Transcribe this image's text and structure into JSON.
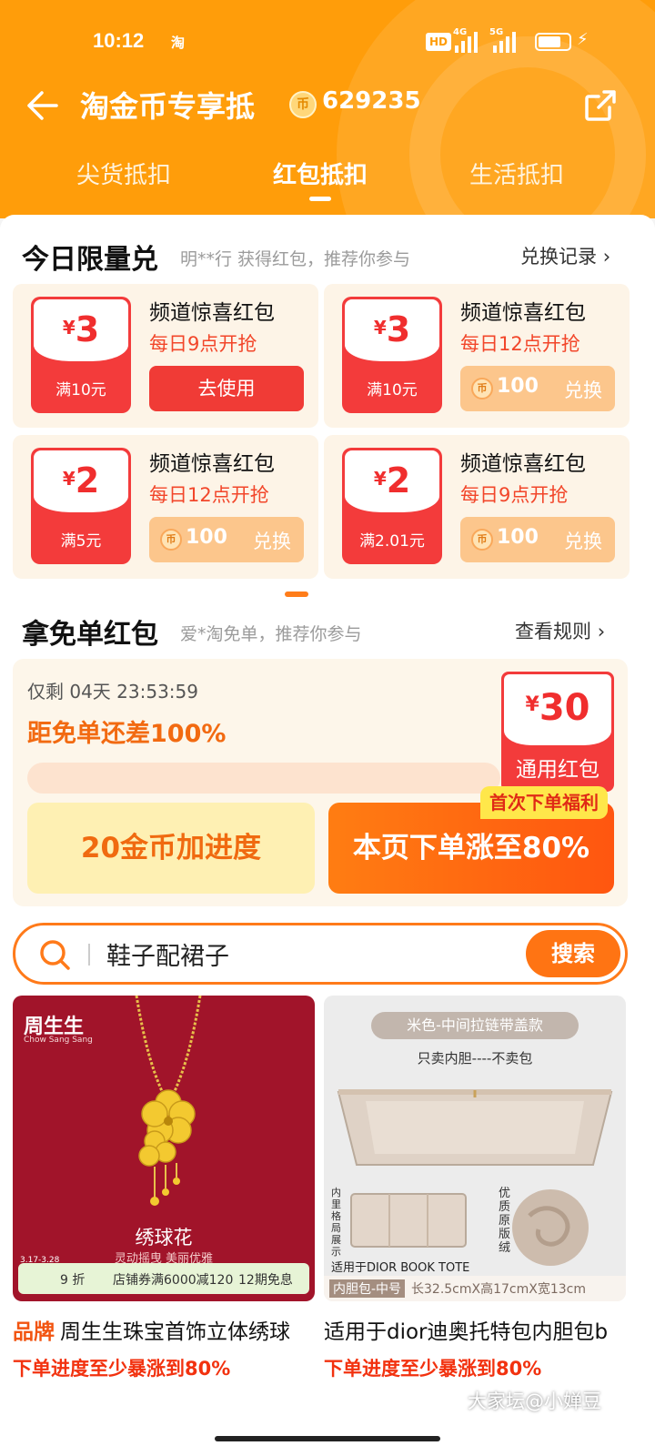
{
  "status": {
    "time": "10:12",
    "app_icon": "淘",
    "hd": "HD",
    "net1": "4G",
    "net2": "5G"
  },
  "header": {
    "title": "淘金币专享抵",
    "coin_count": "629235",
    "coin_glyph": "币"
  },
  "tabs": [
    {
      "label": "尖货抵扣",
      "active": false
    },
    {
      "label": "红包抵扣",
      "active": true
    },
    {
      "label": "生活抵扣",
      "active": false
    }
  ],
  "limited": {
    "title": "今日限量兑",
    "subtitle": "明**行 获得红包，推荐你参与",
    "link": "兑换记录",
    "coupons": [
      {
        "yen": "¥",
        "amount": "3",
        "condition": "满10元",
        "name": "频道惊喜红包",
        "time": "每日9点开抢",
        "action": "去使用"
      },
      {
        "yen": "¥",
        "amount": "3",
        "condition": "满10元",
        "name": "频道惊喜红包",
        "time": "每日12点开抢",
        "cost": "100",
        "action": "兑换"
      },
      {
        "yen": "¥",
        "amount": "2",
        "condition": "满5元",
        "name": "频道惊喜红包",
        "time": "每日12点开抢",
        "cost": "100",
        "action": "兑换"
      },
      {
        "yen": "¥",
        "amount": "2",
        "condition": "满2.01元",
        "name": "频道惊喜红包",
        "time": "每日9点开抢",
        "cost": "100",
        "action": "兑换"
      }
    ]
  },
  "free_order": {
    "title": "拿免单红包",
    "subtitle": "爱*淘免单，推荐你参与",
    "link": "查看规则",
    "countdown": "仅剩 04天 23:53:59",
    "gap": "距免单还差100%",
    "progress_fraction": 0,
    "packet_yen": "¥",
    "packet_amount": "30",
    "packet_label": "通用红包",
    "btn_coin": "20金币加进度",
    "btn_order": "本页下单涨至80%",
    "first_tag": "首次下单福利"
  },
  "search": {
    "value": "鞋子配裙子",
    "button": "搜索"
  },
  "products": [
    {
      "brand": "品牌",
      "title": "周生生珠宝首饰立体绣球",
      "promo": "下单进度至少暴涨到80%",
      "img": {
        "logo": "周生生",
        "logo_en": "Chow Sang Sang",
        "name": "绣球花",
        "desc": "灵动摇曳 美丽优雅",
        "date": "3.17-3.28",
        "s1": "9 折",
        "s2": "店铺券满6000减120",
        "s3": "12期免息"
      }
    },
    {
      "title": "适用于dior迪奥托特包内胆包b",
      "promo": "下单进度至少暴涨到80%",
      "img": {
        "tag": "米色-中间拉链带盖款",
        "note": "只卖内胆----不卖包",
        "side1": "内里格局展示",
        "side2": "优质原版绒",
        "fit": "适用于DIOR BOOK TOTE",
        "s1": "内胆包-中号",
        "s2": "长32.5cmX高17cmX宽13cm"
      }
    }
  ],
  "watermark": "大家坛@小婵豆"
}
